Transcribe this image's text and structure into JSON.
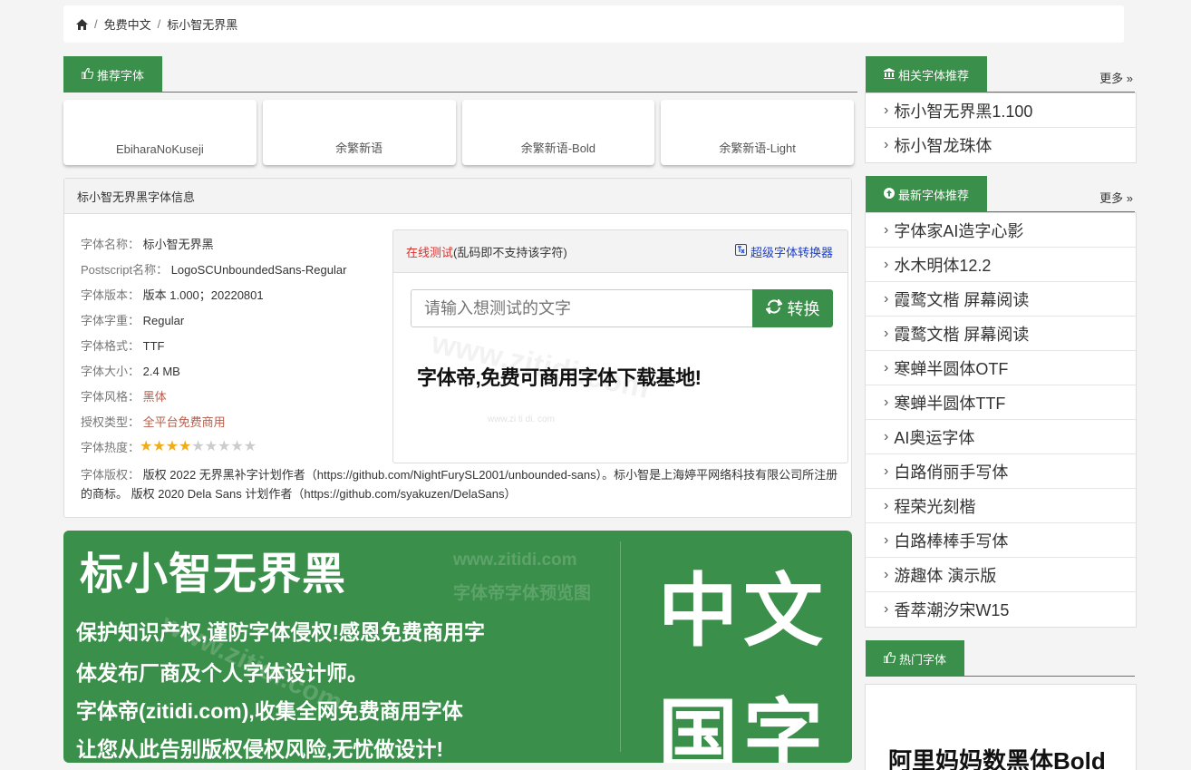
{
  "breadcrumb": {
    "items": [
      "免费中文",
      "标小智无界黑"
    ]
  },
  "recommend": {
    "title": "推荐字体",
    "cards": [
      "EbiharaNoKuseji",
      "余繁新语",
      "余繁新语-Bold",
      "余繁新语-Light"
    ]
  },
  "info": {
    "header": "标小智无界黑字体信息",
    "rows": [
      {
        "label": "字体名称：",
        "value": "标小智无界黑"
      },
      {
        "label": "Postscript名称：",
        "value": "LogoSCUnboundedSans-Regular"
      },
      {
        "label": "字体版本：",
        "value": "版本 1.000；20220801"
      },
      {
        "label": "字体字重：",
        "value": "Regular"
      },
      {
        "label": "字体格式：",
        "value": "TTF"
      },
      {
        "label": "字体大小：",
        "value": "2.4 MB"
      },
      {
        "label": "字体风格：",
        "value": "黑体"
      },
      {
        "label": "授权类型：",
        "value": "全平台免费商用"
      },
      {
        "label": "字体热度：",
        "value": ""
      }
    ],
    "rating": 4,
    "rating_max": 9,
    "copyright_label": "字体版权：",
    "copyright_text": "版权 2022 无界黑补字计划作者（https://github.com/NightFurySL2001/unbounded-sans）。标小智是上海婷平网络科技有限公司所注册的商标。 版权 2020 Dela Sans 计划作者（https://github.com/syakuzen/DelaSans）"
  },
  "tester": {
    "head_red": "在线测试",
    "head_rest": "(乱码即不支持该字符)",
    "converter_link": "超级字体转换器",
    "input_placeholder": "请输入想测试的文字",
    "button_label": "转换",
    "sample_text": "字体帝,免费可商用字体下载基地!",
    "watermark_big": "www.zitidi.com",
    "watermark_small": "www.zi ti di. com"
  },
  "preview": {
    "title": "标小智无界黑",
    "watermark_site": "www.zitidi.com",
    "watermark_caption": "字体帝字体预览图",
    "lines": [
      "保护知识产权,谨防字体侵权!感恩免费商用字",
      "体发布厂商及个人字体设计师。",
      "字体帝(zitidi.com),收集全网免费商用字体",
      "让您从此告别版权侵权风险,无忧做设计!"
    ],
    "big_top": "中文",
    "big_bottom": "国字"
  },
  "related": {
    "title": "相关字体推荐",
    "more": "更多 »",
    "items": [
      "标小智无界黑1.100",
      "标小智龙珠体"
    ]
  },
  "latest": {
    "title": "最新字体推荐",
    "more": "更多 »",
    "items": [
      "字体家AI造字心影",
      "水木明体12.2",
      "霞鹜文楷 屏幕阅读",
      "霞鹜文楷 屏幕阅读",
      "寒蝉半圆体OTF",
      "寒蝉半圆体TTF",
      "AI奥运字体",
      "白路俏丽手写体",
      "程荣光刻楷",
      "白路棒棒手写体",
      "游趣体 演示版",
      "香萃潮汐宋W15"
    ]
  },
  "hot": {
    "title": "热门字体",
    "first_item": "阿里妈妈数黑体Bold"
  },
  "colors": {
    "accent": "#3a8f4a",
    "link_blue": "#1a3fd1",
    "red": "#d9302c",
    "star": "#f0ad1a"
  }
}
